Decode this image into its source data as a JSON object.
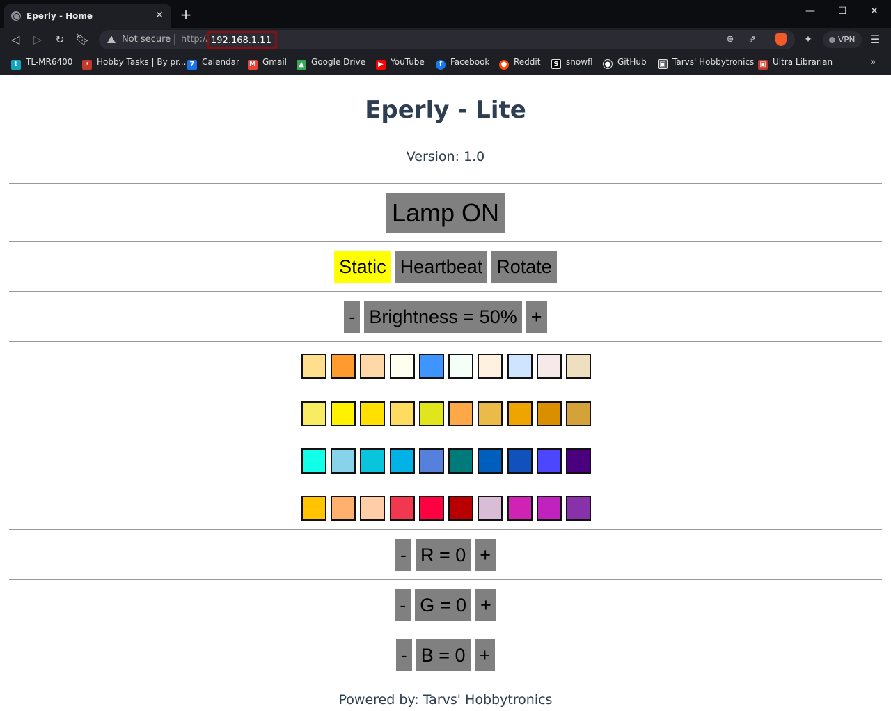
{
  "browser": {
    "tab_title": "Eperly - Home",
    "security_label": "Not secure",
    "url_scheme": "http://",
    "url_host": "192.168.1.11",
    "vpn_label": "VPN",
    "bookmarks": [
      {
        "label": "TL-MR6400",
        "icon": "tplink-icon",
        "color": "#0fa5c0"
      },
      {
        "label": "Hobby Tasks | By pr...",
        "icon": "plug-icon",
        "color": "#c0392b"
      },
      {
        "label": "Calendar",
        "icon": "calendar-icon",
        "color": "#1a73e8"
      },
      {
        "label": "Gmail",
        "icon": "gmail-icon",
        "color": "#ea4335"
      },
      {
        "label": "Google Drive",
        "icon": "drive-icon",
        "color": "#34a853"
      },
      {
        "label": "YouTube",
        "icon": "youtube-icon",
        "color": "#ff0000"
      },
      {
        "label": "Facebook",
        "icon": "facebook-icon",
        "color": "#1877f2"
      },
      {
        "label": "Reddit",
        "icon": "reddit-icon",
        "color": "#ff4500"
      },
      {
        "label": "snowfl",
        "icon": "snowfl-icon",
        "color": "#000000"
      },
      {
        "label": "GitHub",
        "icon": "github-icon",
        "color": "#24292e"
      },
      {
        "label": "Tarvs' Hobbytronics",
        "icon": "chip-icon",
        "color": "#555555"
      },
      {
        "label": "Ultra Librarian",
        "icon": "ultralibrarian-icon",
        "color": "#c0392b"
      }
    ]
  },
  "page": {
    "title": "Eperly - Lite",
    "version": "Version: 1.0",
    "lamp_button": "Lamp ON",
    "modes": [
      {
        "label": "Static",
        "active": true
      },
      {
        "label": "Heartbeat",
        "active": false
      },
      {
        "label": "Rotate",
        "active": false
      }
    ],
    "brightness": {
      "minus": "-",
      "label": "Brightness = 50%",
      "plus": "+"
    },
    "swatch_rows": [
      [
        "#ffdf8e",
        "#ff9a2e",
        "#ffd8aa",
        "#fffff0",
        "#3f95ff",
        "#f3fff7",
        "#fff1e0",
        "#cfe5ff",
        "#f5e9e9",
        "#eedfc1"
      ],
      [
        "#f7ec62",
        "#fff200",
        "#ffe000",
        "#fddc5f",
        "#e1e51c",
        "#ffa847",
        "#ebbb4a",
        "#efa500",
        "#d98f00",
        "#d3a33a"
      ],
      [
        "#12ffe8",
        "#87d3ea",
        "#08c4dc",
        "#00b2e6",
        "#5580dc",
        "#007a7a",
        "#005fbd",
        "#1151bb",
        "#4c46ff",
        "#4a007e"
      ],
      [
        "#ffc300",
        "#ffb06e",
        "#ffcda6",
        "#f2384e",
        "#ff0040",
        "#b90000",
        "#d9bcd6",
        "#cf23b3",
        "#bf22bd",
        "#8931ab"
      ]
    ],
    "red": {
      "minus": "-",
      "label": "R = 0",
      "plus": "+"
    },
    "green": {
      "minus": "-",
      "label": "G = 0",
      "plus": "+"
    },
    "blue": {
      "minus": "-",
      "label": "B = 0",
      "plus": "+"
    },
    "footer": "Powered by: Tarvs' Hobbytronics"
  }
}
